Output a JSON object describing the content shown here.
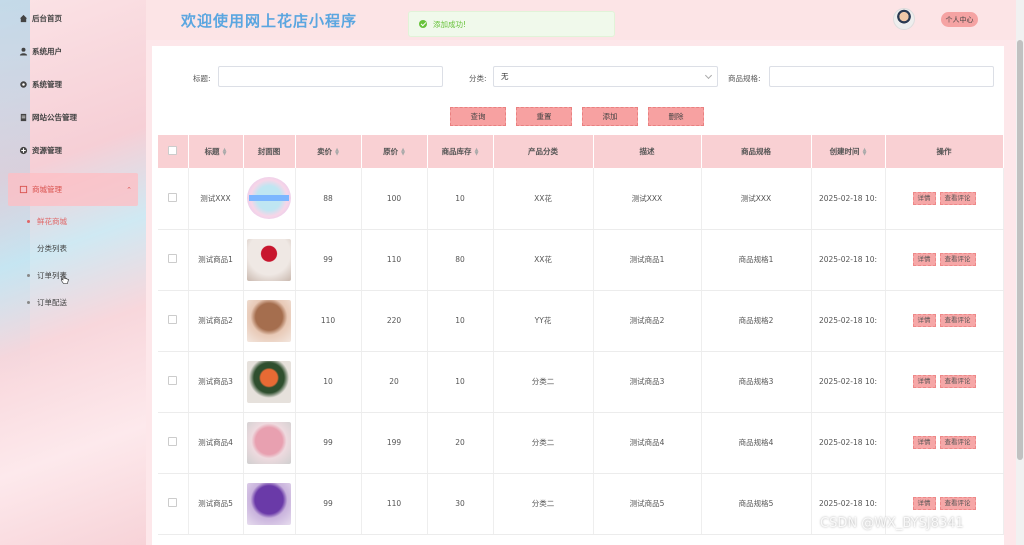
{
  "sidebar": {
    "items": [
      {
        "label": "后台首页",
        "icon": "home-icon"
      },
      {
        "label": "系统用户",
        "icon": "user-icon"
      },
      {
        "label": "系统管理",
        "icon": "gear-icon"
      },
      {
        "label": "网站公告管理",
        "icon": "document-icon"
      },
      {
        "label": "资源管理",
        "icon": "plus-circle-icon"
      },
      {
        "label": "商城管理",
        "icon": "shop-icon"
      }
    ],
    "sub_items": [
      {
        "label": "鲜花商城",
        "active": true
      },
      {
        "label": "分类列表",
        "active": false
      },
      {
        "label": "订单列表",
        "active": false
      },
      {
        "label": "订单配送",
        "active": false
      }
    ]
  },
  "header": {
    "title": "欢迎使用网上花店小程序",
    "toast": "添加成功!",
    "profile_button": "个人中心"
  },
  "filters": {
    "title_label": "标题:",
    "title_value": "",
    "category_label": "分类:",
    "category_value": "无",
    "spec_label": "商品规格:",
    "spec_value": ""
  },
  "actions": {
    "query": "查询",
    "reset": "重置",
    "add": "添加",
    "delete": "删除"
  },
  "table": {
    "headers": [
      "标题",
      "封面图",
      "卖价",
      "原价",
      "商品库存",
      "产品分类",
      "描述",
      "商品规格",
      "创建时间",
      "操作"
    ],
    "detail_label": "详情",
    "review_label": "查看评论",
    "rows": [
      {
        "title": "测试XXX",
        "price": "88",
        "original": "100",
        "stock": "10",
        "category": "XX花",
        "desc": "测试XXX",
        "spec": "测试XXX",
        "created": "2025-02-18 10:"
      },
      {
        "title": "测试商品1",
        "price": "99",
        "original": "110",
        "stock": "80",
        "category": "XX花",
        "desc": "测试商品1",
        "spec": "商品规格1",
        "created": "2025-02-18 10:"
      },
      {
        "title": "测试商品2",
        "price": "110",
        "original": "220",
        "stock": "10",
        "category": "YY花",
        "desc": "测试商品2",
        "spec": "商品规格2",
        "created": "2025-02-18 10:"
      },
      {
        "title": "测试商品3",
        "price": "10",
        "original": "20",
        "stock": "10",
        "category": "分类二",
        "desc": "测试商品3",
        "spec": "商品规格3",
        "created": "2025-02-18 10:"
      },
      {
        "title": "测试商品4",
        "price": "99",
        "original": "199",
        "stock": "20",
        "category": "分类二",
        "desc": "测试商品4",
        "spec": "商品规格4",
        "created": "2025-02-18 10:"
      },
      {
        "title": "测试商品5",
        "price": "99",
        "original": "110",
        "stock": "30",
        "category": "分类二",
        "desc": "测试商品5",
        "spec": "商品规格5",
        "created": "2025-02-18 10:"
      }
    ]
  },
  "watermark": "CSDN @WX_BYSJ8341",
  "colors": {
    "accent": "#f7a1a1",
    "title_blue": "#5ba6e0",
    "success": "#67c23a",
    "header_bg": "#fce4e6"
  }
}
